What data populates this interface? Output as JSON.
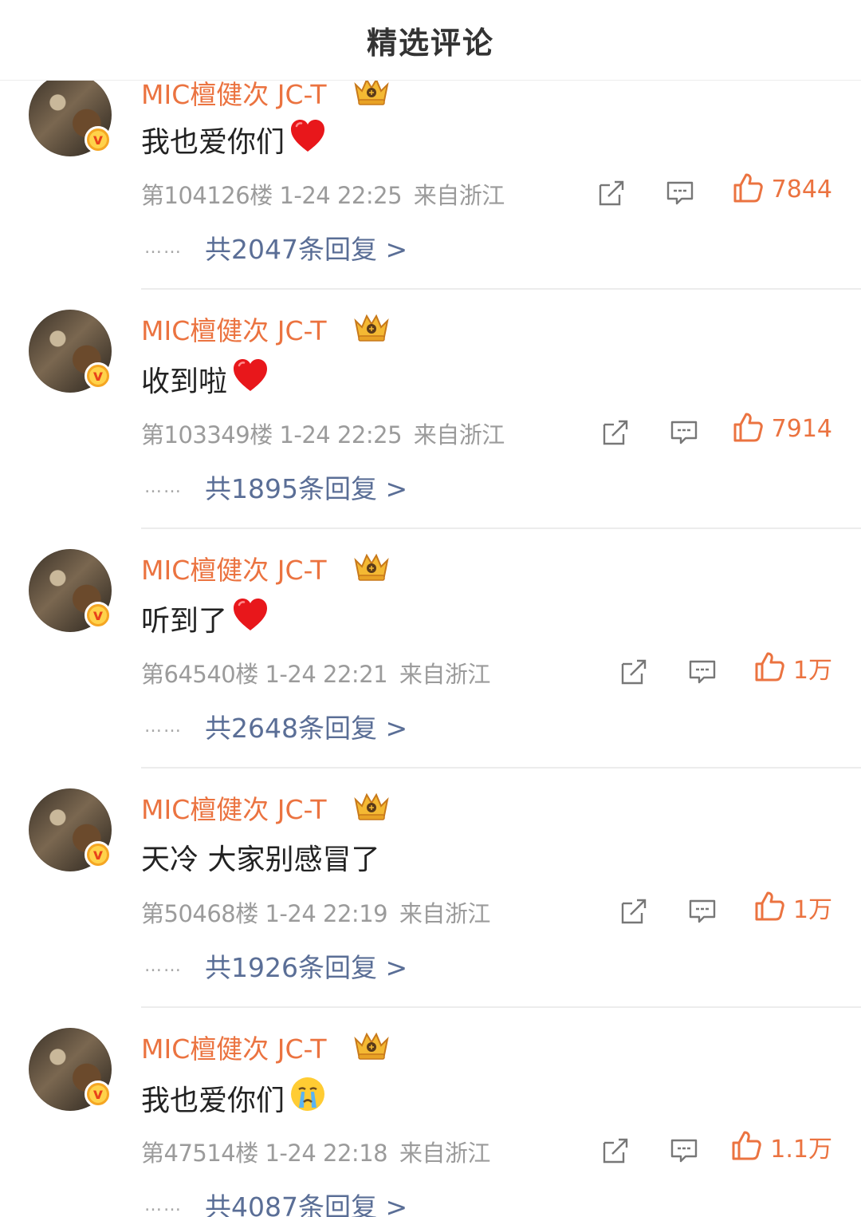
{
  "header": {
    "title": "精选评论"
  },
  "colors": {
    "accent": "#eb7340",
    "link": "#5a6e96",
    "meta": "#9b9b9b"
  },
  "comments": [
    {
      "username": "MIC檀健次 JC-T",
      "text": "我也爱你们",
      "emoji": "red-heart",
      "floor": "第104126楼",
      "time": "1-24 22:25",
      "location": "来自浙江",
      "likes": "7844",
      "replies": "共2047条回复 >"
    },
    {
      "username": "MIC檀健次 JC-T",
      "text": "收到啦 ",
      "emoji": "red-heart",
      "floor": "第103349楼",
      "time": "1-24 22:25",
      "location": "来自浙江",
      "likes": "7914",
      "replies": "共1895条回复 >"
    },
    {
      "username": "MIC檀健次 JC-T",
      "text": "听到了",
      "emoji": "red-heart",
      "floor": "第64540楼",
      "time": "1-24 22:21",
      "location": "来自浙江",
      "likes": "1万",
      "replies": "共2648条回复 >"
    },
    {
      "username": "MIC檀健次 JC-T",
      "text": "天冷 大家别感冒了",
      "emoji": "",
      "floor": "第50468楼",
      "time": "1-24 22:19",
      "location": "来自浙江",
      "likes": "1万",
      "replies": "共1926条回复 >"
    },
    {
      "username": "MIC檀健次 JC-T",
      "text": "我也爱你们",
      "emoji": "crying-face",
      "floor": "第47514楼",
      "time": "1-24 22:18",
      "location": "来自浙江",
      "likes": "1.1万",
      "replies": "共4087条回复 >"
    }
  ]
}
